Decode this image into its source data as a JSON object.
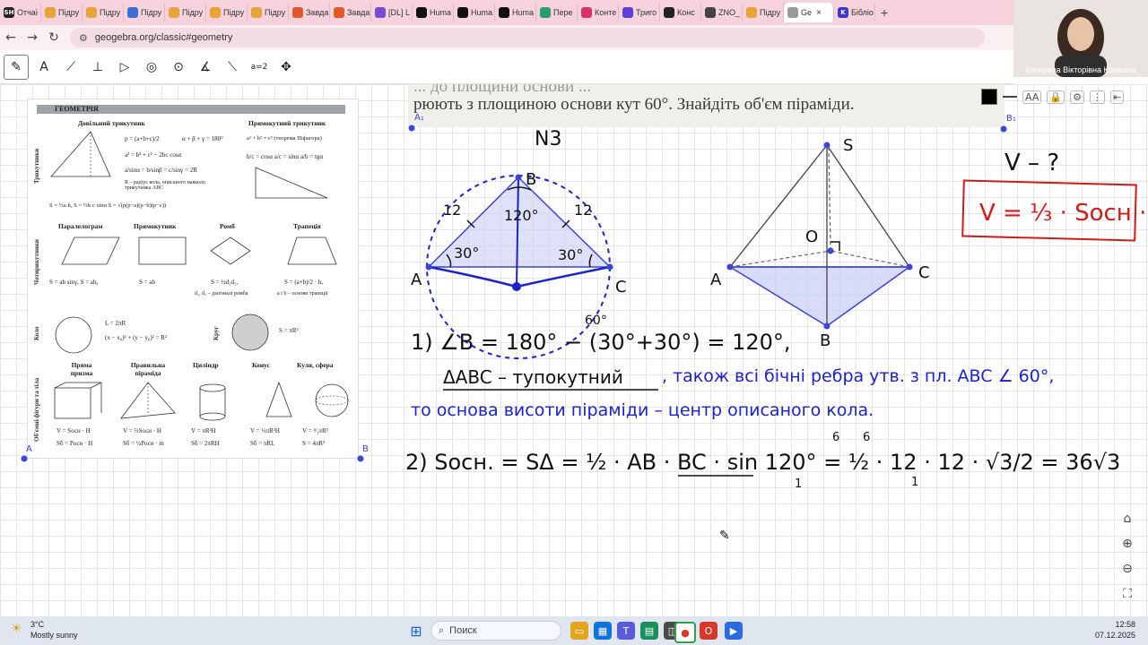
{
  "browser": {
    "tabs": [
      {
        "label": "Отчаі",
        "fav": "SH",
        "color": "#222222"
      },
      {
        "label": "Підру",
        "fav": "",
        "color": "#e8a33c"
      },
      {
        "label": "Підру",
        "fav": "",
        "color": "#e8a33c"
      },
      {
        "label": "Підру",
        "fav": "",
        "color": "#3b6fd6"
      },
      {
        "label": "Підру",
        "fav": "",
        "color": "#e8a33c"
      },
      {
        "label": "Підру",
        "fav": "",
        "color": "#e8a33c"
      },
      {
        "label": "Підру",
        "fav": "",
        "color": "#e8a33c"
      },
      {
        "label": "Завда",
        "fav": "",
        "color": "#e0592a"
      },
      {
        "label": "Завда",
        "fav": "",
        "color": "#e0592a"
      },
      {
        "label": "[DL] L",
        "fav": "",
        "color": "#7a4bd1"
      },
      {
        "label": "Huma",
        "fav": "",
        "color": "#111111"
      },
      {
        "label": "Huma",
        "fav": "",
        "color": "#111111"
      },
      {
        "label": "Huma",
        "fav": "",
        "color": "#111111"
      },
      {
        "label": "Пере",
        "fav": "",
        "color": "#2a9d6f"
      },
      {
        "label": "Конте",
        "fav": "",
        "color": "#d6336c"
      },
      {
        "label": "Триго",
        "fav": "",
        "color": "#5b3fd6"
      },
      {
        "label": "Конс",
        "fav": "",
        "color": "#222222"
      },
      {
        "label": "ZNO_",
        "fav": "",
        "color": "#444444"
      },
      {
        "label": "Підру",
        "fav": "",
        "color": "#e8a33c"
      },
      {
        "label": "Ge",
        "fav": "",
        "color": "#9a9a9a",
        "active": true
      },
      {
        "label": "Бібліо",
        "fav": "K",
        "color": "#3a39c4"
      }
    ],
    "url": "geogebra.org/classic#geometry"
  },
  "webcam": {
    "name": "Катерина Вікторівна Ковязіна"
  },
  "toolbar": {
    "tools": [
      {
        "name": "pen-tool",
        "glyph": "✎"
      },
      {
        "name": "point-tool",
        "glyph": "A"
      },
      {
        "name": "line-tool",
        "glyph": "⟋"
      },
      {
        "name": "perpendicular-tool",
        "glyph": "⊥"
      },
      {
        "name": "polygon-tool",
        "glyph": "▷"
      },
      {
        "name": "circle-tool",
        "glyph": "◎"
      },
      {
        "name": "circle-points-tool",
        "glyph": "⊙"
      },
      {
        "name": "angle-tool",
        "glyph": "∡"
      },
      {
        "name": "reflect-tool",
        "glyph": "⟍"
      },
      {
        "name": "slider-tool",
        "glyph": "a=2"
      },
      {
        "name": "move-view-tool",
        "glyph": "✥"
      }
    ]
  },
  "reference_sheet": {
    "title": "ГЕОМЕТРІЯ",
    "sections": {
      "triangles": "Трикутники",
      "quadrilaterals": "Чотирикутники",
      "circle": "Коло",
      "disk": "Круг",
      "solids": "Об'ємні фігури та тіла"
    },
    "headings": {
      "arbitrary_triangle": "Довільний трикутник",
      "right_triangle": "Прямокутний трикутник",
      "parallelogram": "Паралелограм",
      "rectangle": "Прямокутник",
      "rhombus": "Ромб",
      "trapezoid": "Трапеція",
      "prism": "Пряма призма",
      "pyramid": "Правильна піраміда",
      "cylinder": "Циліндр",
      "cone": "Конус",
      "sphere": "Куля, сфера"
    },
    "formulas": {
      "half_perimeter": "p = (a+b+c)/2",
      "angle_sum": "α + β + γ = 180°",
      "cosine_law": "a² = b² + c² − 2bc cosα",
      "sine_law": "a/sinα = b/sinβ = c/sinγ = 2R",
      "circumradius_note": "R – радіус кола, описаного навколо трикутника ABC",
      "area_triangle": "S = ½a·hₐ   S = ½b·c·sinα   S = √(p(p−a)(p−b)(p−c))",
      "pythagoras": "a² + b² = c² (теорема Піфагора)",
      "right_trig": "b/c = cosα   a/c = sinα   a/b = tgα",
      "parallelogram_area": "S = ab sinγ,  S = ahₐ",
      "rectangle_area": "S = ab",
      "rhombus_area": "S = ½d₁d₂,",
      "rhombus_note": "d₁, d₂ – діагоналі ромба",
      "trapezoid_area": "S = (a+b)/2 · h,",
      "trapezoid_note": "a і b – основи трапеції",
      "circle_length": "L = 2πR",
      "circle_eq": "(x − x₀)² + (y − y₀)² = R²",
      "disk_area": "S = πR²",
      "prism_volume": "V = Sосн · H",
      "prism_side": "Sб = Pосн · H",
      "pyramid_volume": "V = ⅓Sосн · H",
      "pyramid_side": "Sб = ½Pосн · m",
      "cylinder_volume": "V = πR²H",
      "cylinder_side": "Sб = 2πRH",
      "cone_volume": "V = ⅓πR²H",
      "cone_side": "Sб = πRL",
      "sphere_volume": "V = ⁴⁄₃πR³",
      "sphere_area": "S = 4πR²"
    }
  },
  "problem_strip": {
    "cut_text": "... до площини основи ...",
    "text": "рюють з площиною основи кут 60°. Знайдіть об'єм піраміди."
  },
  "canvas": {
    "problem_number": "N3",
    "labels": {
      "A": "A",
      "B": "B",
      "C": "C",
      "S": "S",
      "O": "O",
      "A1": "A₁",
      "B1": "B₁",
      "A_ref": "A",
      "B_ref": "B"
    },
    "triangle": {
      "side_left": "12",
      "side_right": "12",
      "angle_A": "30°",
      "angle_C": "30°",
      "angle_B": "120°",
      "angle_60": "60°"
    },
    "question": "V – ?",
    "volume_formula": "V = ⅓ · Sосн · h",
    "step1_line1": "1)  ∠B = 180° − (30°+30°) = 120°,",
    "step1_line2": "ΔABC – тупокутний",
    "step1_blue_a": ", також всі бічні ребра утв. з пл. ABC ∠ 60°,",
    "step1_blue_b": "то основа висоти піраміди – центр описаного кола.",
    "step2": "2)  Sосн. = SΔ = ½ · AB · BC · sin 120° = ½ · 12 · 12 · √3/2 = 36√3",
    "step2_small": [
      "6",
      "6",
      "1",
      "1"
    ]
  },
  "style_bar": {
    "font_size_icon": "AA"
  },
  "taskbar": {
    "weather_temp": "3°C",
    "weather_text": "Mostly sunny",
    "search_placeholder": "Поиск",
    "time": "12:58",
    "date": "07.12.2025"
  },
  "colors": {
    "handwriting_black": "#111111",
    "handwriting_blue": "#1d23c9",
    "handwriting_red": "#d21a1a",
    "point_blue": "#3b45d6",
    "fill_blue": "#c9cdf5"
  }
}
